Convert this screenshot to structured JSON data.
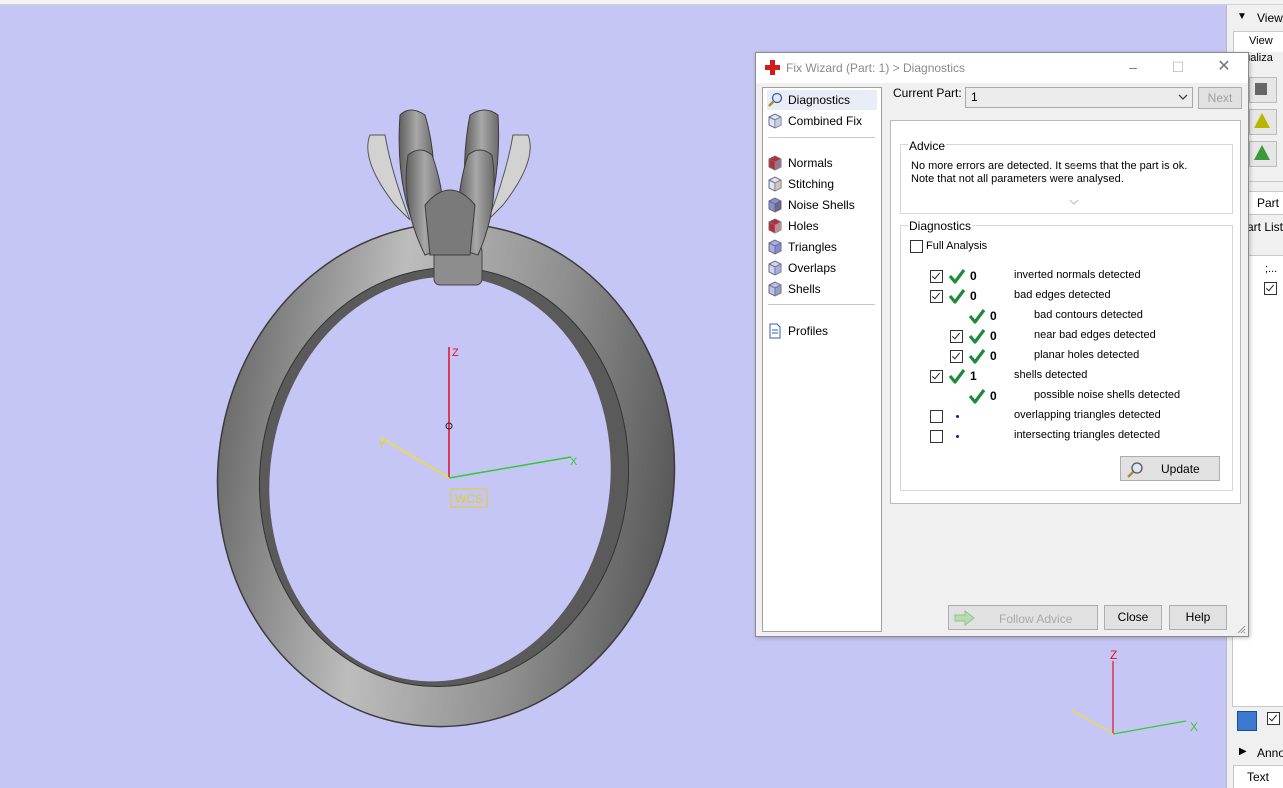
{
  "dialog": {
    "title": "Fix Wizard (Part: 1) > Diagnostics",
    "nav": {
      "top": [
        {
          "label": "Diagnostics",
          "icon": "magnifier-icon",
          "selected": true
        },
        {
          "label": "Combined Fix",
          "icon": "cube-icon"
        }
      ],
      "middle": [
        {
          "label": "Normals",
          "icon": "normals-cube-icon"
        },
        {
          "label": "Stitching",
          "icon": "stitching-cube-icon"
        },
        {
          "label": "Noise Shells",
          "icon": "noise-shells-icon"
        },
        {
          "label": "Holes",
          "icon": "holes-cube-icon"
        },
        {
          "label": "Triangles",
          "icon": "triangles-cube-icon"
        },
        {
          "label": "Overlaps",
          "icon": "overlaps-cube-icon"
        },
        {
          "label": "Shells",
          "icon": "shells-cube-icon"
        }
      ],
      "bottom": [
        {
          "label": "Profiles",
          "icon": "document-icon"
        }
      ]
    },
    "current_part_label": "Current Part:",
    "current_part_value": "1",
    "next_label": "Next",
    "advice": {
      "title": "Advice",
      "text_line1": "No more errors are detected. It seems that the part is ok.",
      "text_line2": "Note that not all parameters were analysed."
    },
    "diagnostics": {
      "title": "Diagnostics",
      "full_analysis_label": "Full Analysis",
      "full_analysis_checked": false,
      "rows": [
        {
          "checkbox": true,
          "checked": true,
          "status": "ok",
          "count": "0",
          "label": "inverted normals detected",
          "indent": 0
        },
        {
          "checkbox": true,
          "checked": true,
          "status": "ok",
          "count": "0",
          "label": "bad edges detected",
          "indent": 0
        },
        {
          "checkbox": false,
          "checked": false,
          "status": "ok",
          "count": "0",
          "label": "bad contours detected",
          "indent": 1
        },
        {
          "checkbox": true,
          "checked": true,
          "status": "ok",
          "count": "0",
          "label": "near bad edges detected",
          "indent": 1
        },
        {
          "checkbox": true,
          "checked": true,
          "status": "ok",
          "count": "0",
          "label": "planar holes detected",
          "indent": 1
        },
        {
          "checkbox": true,
          "checked": true,
          "status": "ok",
          "count": "1",
          "label": "shells detected",
          "indent": 0
        },
        {
          "checkbox": false,
          "checked": false,
          "status": "ok",
          "count": "0",
          "label": "possible noise shells detected",
          "indent": 1
        },
        {
          "checkbox": true,
          "checked": false,
          "status": "dot",
          "count": "",
          "label": "overlapping triangles detected",
          "indent": 0
        },
        {
          "checkbox": true,
          "checked": false,
          "status": "dot",
          "count": "",
          "label": "intersecting triangles detected",
          "indent": 0
        }
      ],
      "update_label": "Update"
    },
    "footer": {
      "follow_advice_label": "Follow Advice",
      "close_label": "Close",
      "help_label": "Help"
    }
  },
  "viewport": {
    "wcs_label": "WCS",
    "axes": {
      "x": "X",
      "y": "Y",
      "z": "Z"
    }
  },
  "right_panel": {
    "view_header": "View",
    "view_tab": "View",
    "visualize_label": "Visualiza",
    "part_tab": "Part P",
    "part_list_label": "art List",
    "list_cell": ";...",
    "annotations_header": "Annot",
    "text_tab": "Text"
  },
  "colors": {
    "viewport_bg": "#c6c6f6",
    "axis_x": "#2ecc2e",
    "axis_y": "#f0e020",
    "axis_z": "#e01020",
    "tick_green": "#1e8a3c"
  }
}
